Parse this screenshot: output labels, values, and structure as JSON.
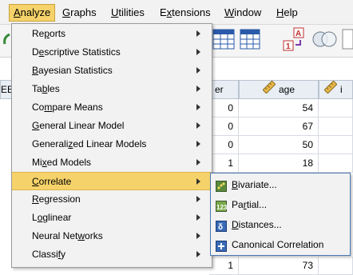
{
  "menubar": {
    "items": [
      {
        "label": "Analyze",
        "ul": "A",
        "rest": "nalyze"
      },
      {
        "label": "Graphs",
        "ul": "G",
        "rest": "raphs"
      },
      {
        "label": "Utilities",
        "ul": "U",
        "rest": "tilities"
      },
      {
        "label": "Extensions",
        "ul": "x",
        "pre": "E",
        "rest": "tensions"
      },
      {
        "label": "Window",
        "ul": "W",
        "rest": "indow"
      },
      {
        "label": "Help",
        "ul": "H",
        "rest": "elp"
      }
    ]
  },
  "analyze_menu": {
    "items": [
      {
        "pre": "Re",
        "ul": "p",
        "rest": "orts"
      },
      {
        "pre": "D",
        "ul": "e",
        "rest": "scriptive Statistics"
      },
      {
        "pre": "",
        "ul": "B",
        "rest": "ayesian Statistics"
      },
      {
        "pre": "Ta",
        "ul": "b",
        "rest": "les"
      },
      {
        "pre": "Co",
        "ul": "m",
        "rest": "pare Means"
      },
      {
        "pre": "",
        "ul": "G",
        "rest": "eneral Linear Model"
      },
      {
        "pre": "Generali",
        "ul": "z",
        "rest": "ed Linear Models"
      },
      {
        "pre": "Mi",
        "ul": "x",
        "rest": "ed Models"
      },
      {
        "pre": "",
        "ul": "C",
        "rest": "orrelate"
      },
      {
        "pre": "",
        "ul": "R",
        "rest": "egression"
      },
      {
        "pre": "L",
        "ul": "o",
        "rest": "glinear"
      },
      {
        "pre": "Neural Net",
        "ul": "w",
        "rest": "orks"
      },
      {
        "pre": "Classi",
        "ul": "f",
        "rest": "y"
      }
    ],
    "highlighted": "Correlate"
  },
  "correlate_submenu": {
    "items": [
      {
        "pre": "",
        "ul": "B",
        "rest": "ivariate...",
        "icon": "bivariate-icon"
      },
      {
        "pre": "Pa",
        "ul": "r",
        "rest": "tial...",
        "icon": "partial-icon"
      },
      {
        "pre": "",
        "ul": "D",
        "rest": "istances...",
        "icon": "distances-icon"
      },
      {
        "pre": "Canonical Correlation",
        "ul": "",
        "rest": "",
        "icon": "canonical-correlation-icon"
      }
    ]
  },
  "grid": {
    "partial_header_left": "EE",
    "col_partial_label": "er",
    "col_age_label": "age",
    "col3_partial_label": "i",
    "col_er_values": [
      "0",
      "0",
      "0",
      "1",
      "1"
    ],
    "col_age_values": [
      "54",
      "67",
      "50",
      "18",
      "73"
    ]
  },
  "colors": {
    "menu_highlight": "#f6d36a",
    "submenu_border": "#4a78b5"
  }
}
